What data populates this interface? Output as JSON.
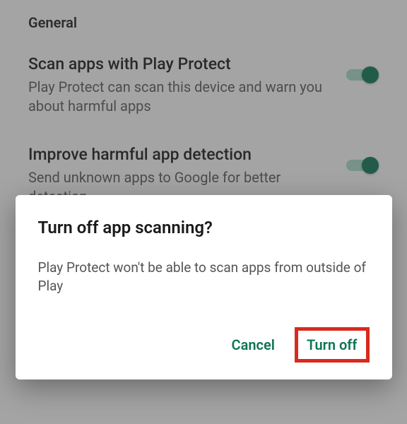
{
  "section": {
    "header": "General"
  },
  "settings": {
    "scan": {
      "title": "Scan apps with Play Protect",
      "desc": "Play Protect can scan this device and warn you about harmful apps"
    },
    "improve": {
      "title": "Improve harmful app detection",
      "desc": "Send unknown apps to Google for better detection"
    }
  },
  "dialog": {
    "title": "Turn off app scanning?",
    "body": "Play Protect won't be able to scan apps from outside of Play",
    "cancel": "Cancel",
    "confirm": "Turn off"
  },
  "colors": {
    "accent": "#0d7554",
    "highlight": "#d82a1c"
  }
}
